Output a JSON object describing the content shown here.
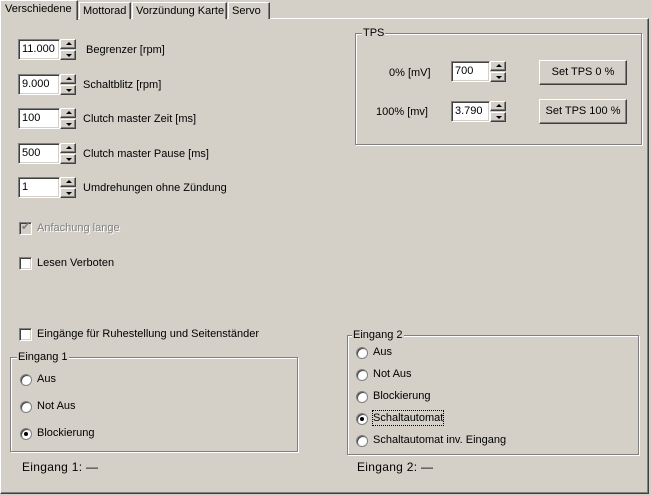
{
  "tabs": [
    "Verschiedene",
    "Mottorad",
    "Vorzündung Karte",
    "Servo"
  ],
  "fields": [
    {
      "value": "11.000",
      "label": "Begrenzer [rpm]"
    },
    {
      "value": "9.000",
      "label": "Schaltblitz [rpm]"
    },
    {
      "value": "100",
      "label": "Clutch master Zeit [ms]"
    },
    {
      "value": "500",
      "label": "Clutch master Pause [ms]"
    },
    {
      "value": "1",
      "label": "Umdrehungen ohne Zündung"
    }
  ],
  "checkboxes": {
    "anfachung": {
      "label": "Anfachung lange",
      "checked": true,
      "disabled": true
    },
    "lesen": {
      "label": "Lesen Verboten",
      "checked": false
    },
    "eingaenge": {
      "label": "Eingänge für Ruhestellung und Seitenständer",
      "checked": false
    }
  },
  "tps": {
    "title": "TPS",
    "rows": [
      {
        "label": "0%  [mV]",
        "value": "700",
        "button": "Set TPS 0 %"
      },
      {
        "label": "100%  [mv]",
        "value": "3.790",
        "button": "Set TPS 100 %"
      }
    ]
  },
  "eingang1": {
    "title": "Eingang 1",
    "options": [
      "Aus",
      "Not Aus",
      "Blockierung"
    ],
    "selected": 2,
    "status": "Eingang 1: —"
  },
  "eingang2": {
    "title": "Eingang 2",
    "options": [
      "Aus",
      "Not Aus",
      "Blockierung",
      "Schaltautomat",
      "Schaltautomat inv. Eingang"
    ],
    "selected": 3,
    "status": "Eingang 2: —"
  }
}
